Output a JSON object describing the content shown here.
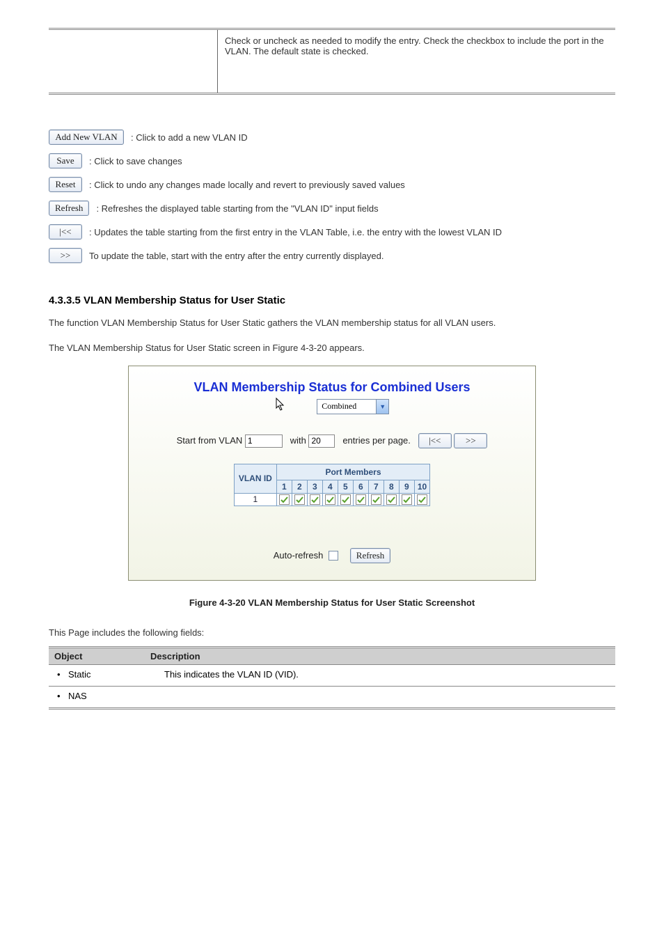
{
  "topTable": {
    "leftCell": "",
    "rightCell": "Check or uncheck as needed to modify the entry. Check the checkbox to include the port in the VLAN. The default state is checked."
  },
  "buttons": [
    {
      "key": "add",
      "label": "Add New VLAN",
      "desc": ": Click to add a new VLAN ID"
    },
    {
      "key": "save",
      "label": "Save",
      "desc": ": Click to save changes"
    },
    {
      "key": "reset",
      "label": "Reset",
      "desc": ": Click to undo any changes made locally and revert to previously saved values"
    },
    {
      "key": "refresh",
      "label": "Refresh",
      "desc": ": Refreshes the displayed table starting from the \"VLAN ID\" input fields"
    },
    {
      "key": "first",
      "label": "|<<",
      "desc": ": Updates the table starting from the first entry in the VLAN Table, i.e. the entry with the lowest VLAN ID"
    },
    {
      "key": "next",
      "label": ">>",
      "desc": "To update the table, start with the entry after the entry currently displayed."
    }
  ],
  "sectionHeading": "4.3.3.5 VLAN Membership Status for User Static",
  "sectionPara": "The function VLAN Membership Status for User Static gathers the VLAN membership status for all VLAN users.",
  "figCaption": "The VLAN Membership Status for User Static screen in Figure 4-3-20 appears.",
  "screenshot": {
    "title": "VLAN Membership Status for Combined Users",
    "combobox": "Combined",
    "startLabel": "Start from VLAN",
    "startVal": "1",
    "withLabel": "with",
    "withVal": "20",
    "perPage": "entries per page.",
    "navFirst": "|<<",
    "navNext": ">>",
    "portMembersHdr": "Port Members",
    "vlanIdHdr": "VLAN ID",
    "ports": [
      "1",
      "2",
      "3",
      "4",
      "5",
      "6",
      "7",
      "8",
      "9",
      "10"
    ],
    "rowVlanId": "1",
    "autoRefresh": "Auto-refresh",
    "refreshBtn": "Refresh"
  },
  "figLabel": "Figure 4-3-20 VLAN Membership Status for User Static Screenshot",
  "introPara": "This Page includes the following fields:",
  "bottomTable": {
    "hLeft": "Object",
    "hRight": "Description",
    "rows": [
      {
        "obj": "Static",
        "desc": "This indicates the VLAN ID (VID)."
      },
      {
        "obj": "NAS",
        "desc": ""
      }
    ]
  }
}
